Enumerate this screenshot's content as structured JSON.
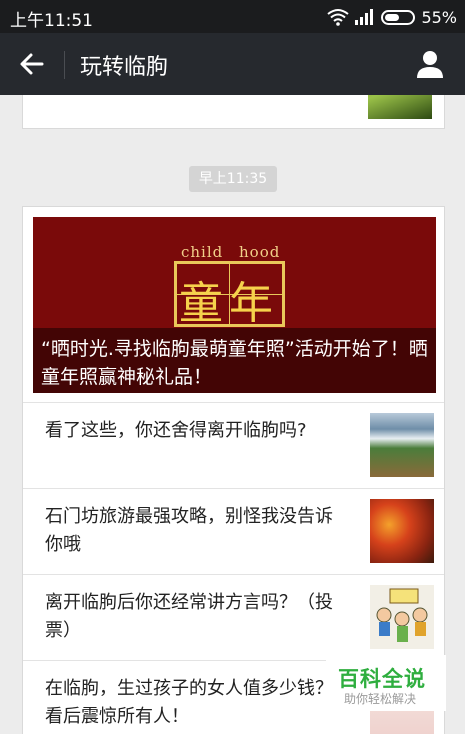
{
  "status_bar": {
    "time": "上午11:51",
    "battery": "55%"
  },
  "header": {
    "title": "玩转临朐"
  },
  "timestamp": "早上11:35",
  "cover_article": {
    "image_text_en_1": "child",
    "image_text_en_2": "hood",
    "image_text_cn": "童年",
    "title": "“晒时光.寻找临朐最萌童年照”活动开始了！晒童年照赢神秘礼品！"
  },
  "articles": [
    {
      "title": "看了这些，你还舍得离开临朐吗?",
      "icon": "waterfall-thumbnail"
    },
    {
      "title": "石门坊旅游最强攻略，别怪我没告诉你哦",
      "icon": "autumn-leaves-thumbnail"
    },
    {
      "title": "离开临朐后你还经常讲方言吗？（投票）",
      "icon": "cartoon-thumbnail"
    },
    {
      "title": "在临朐，生过孩子的女人值多少钱？看后震惊所有人！",
      "icon": "baby-thumbnail"
    }
  ],
  "watermark": {
    "main": "百科全说",
    "sub": "助你轻松解决"
  },
  "colors": {
    "status_bar": "#1b1c1e",
    "title_bar": "#26292e",
    "cover_bg": "#7a0a0a",
    "watermark_green": "#2fae3f"
  }
}
